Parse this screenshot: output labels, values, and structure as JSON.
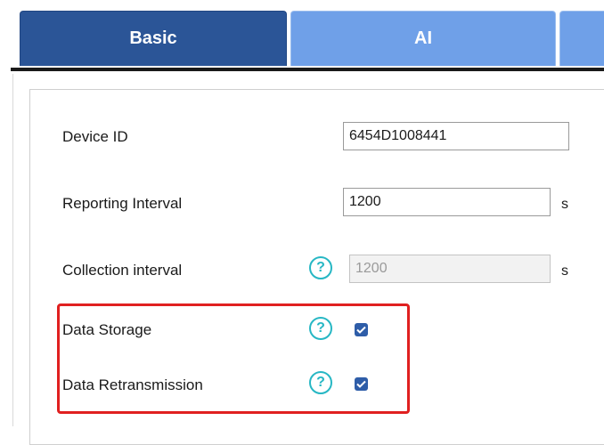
{
  "tabs": [
    {
      "label": "Basic",
      "active": true
    },
    {
      "label": "AI",
      "active": false
    },
    {
      "label": "",
      "active": false
    }
  ],
  "form": {
    "device_id": {
      "label": "Device ID",
      "value": "6454D1008441"
    },
    "reporting_interval": {
      "label": "Reporting Interval",
      "value": "1200",
      "unit": "s"
    },
    "collection_interval": {
      "label": "Collection interval",
      "value": "1200",
      "unit": "s",
      "disabled": true,
      "help_icon": "question-circle-icon"
    },
    "data_storage": {
      "label": "Data Storage",
      "checked": true,
      "help_icon": "question-circle-icon"
    },
    "data_retransmission": {
      "label": "Data Retransmission",
      "checked": true,
      "help_icon": "question-circle-icon"
    }
  },
  "colors": {
    "tab_active": "#2b5597",
    "tab_inactive": "#6fa0e8",
    "help_icon": "#27b7c4",
    "checkbox": "#2e5da8",
    "highlight_box": "#e02020"
  }
}
